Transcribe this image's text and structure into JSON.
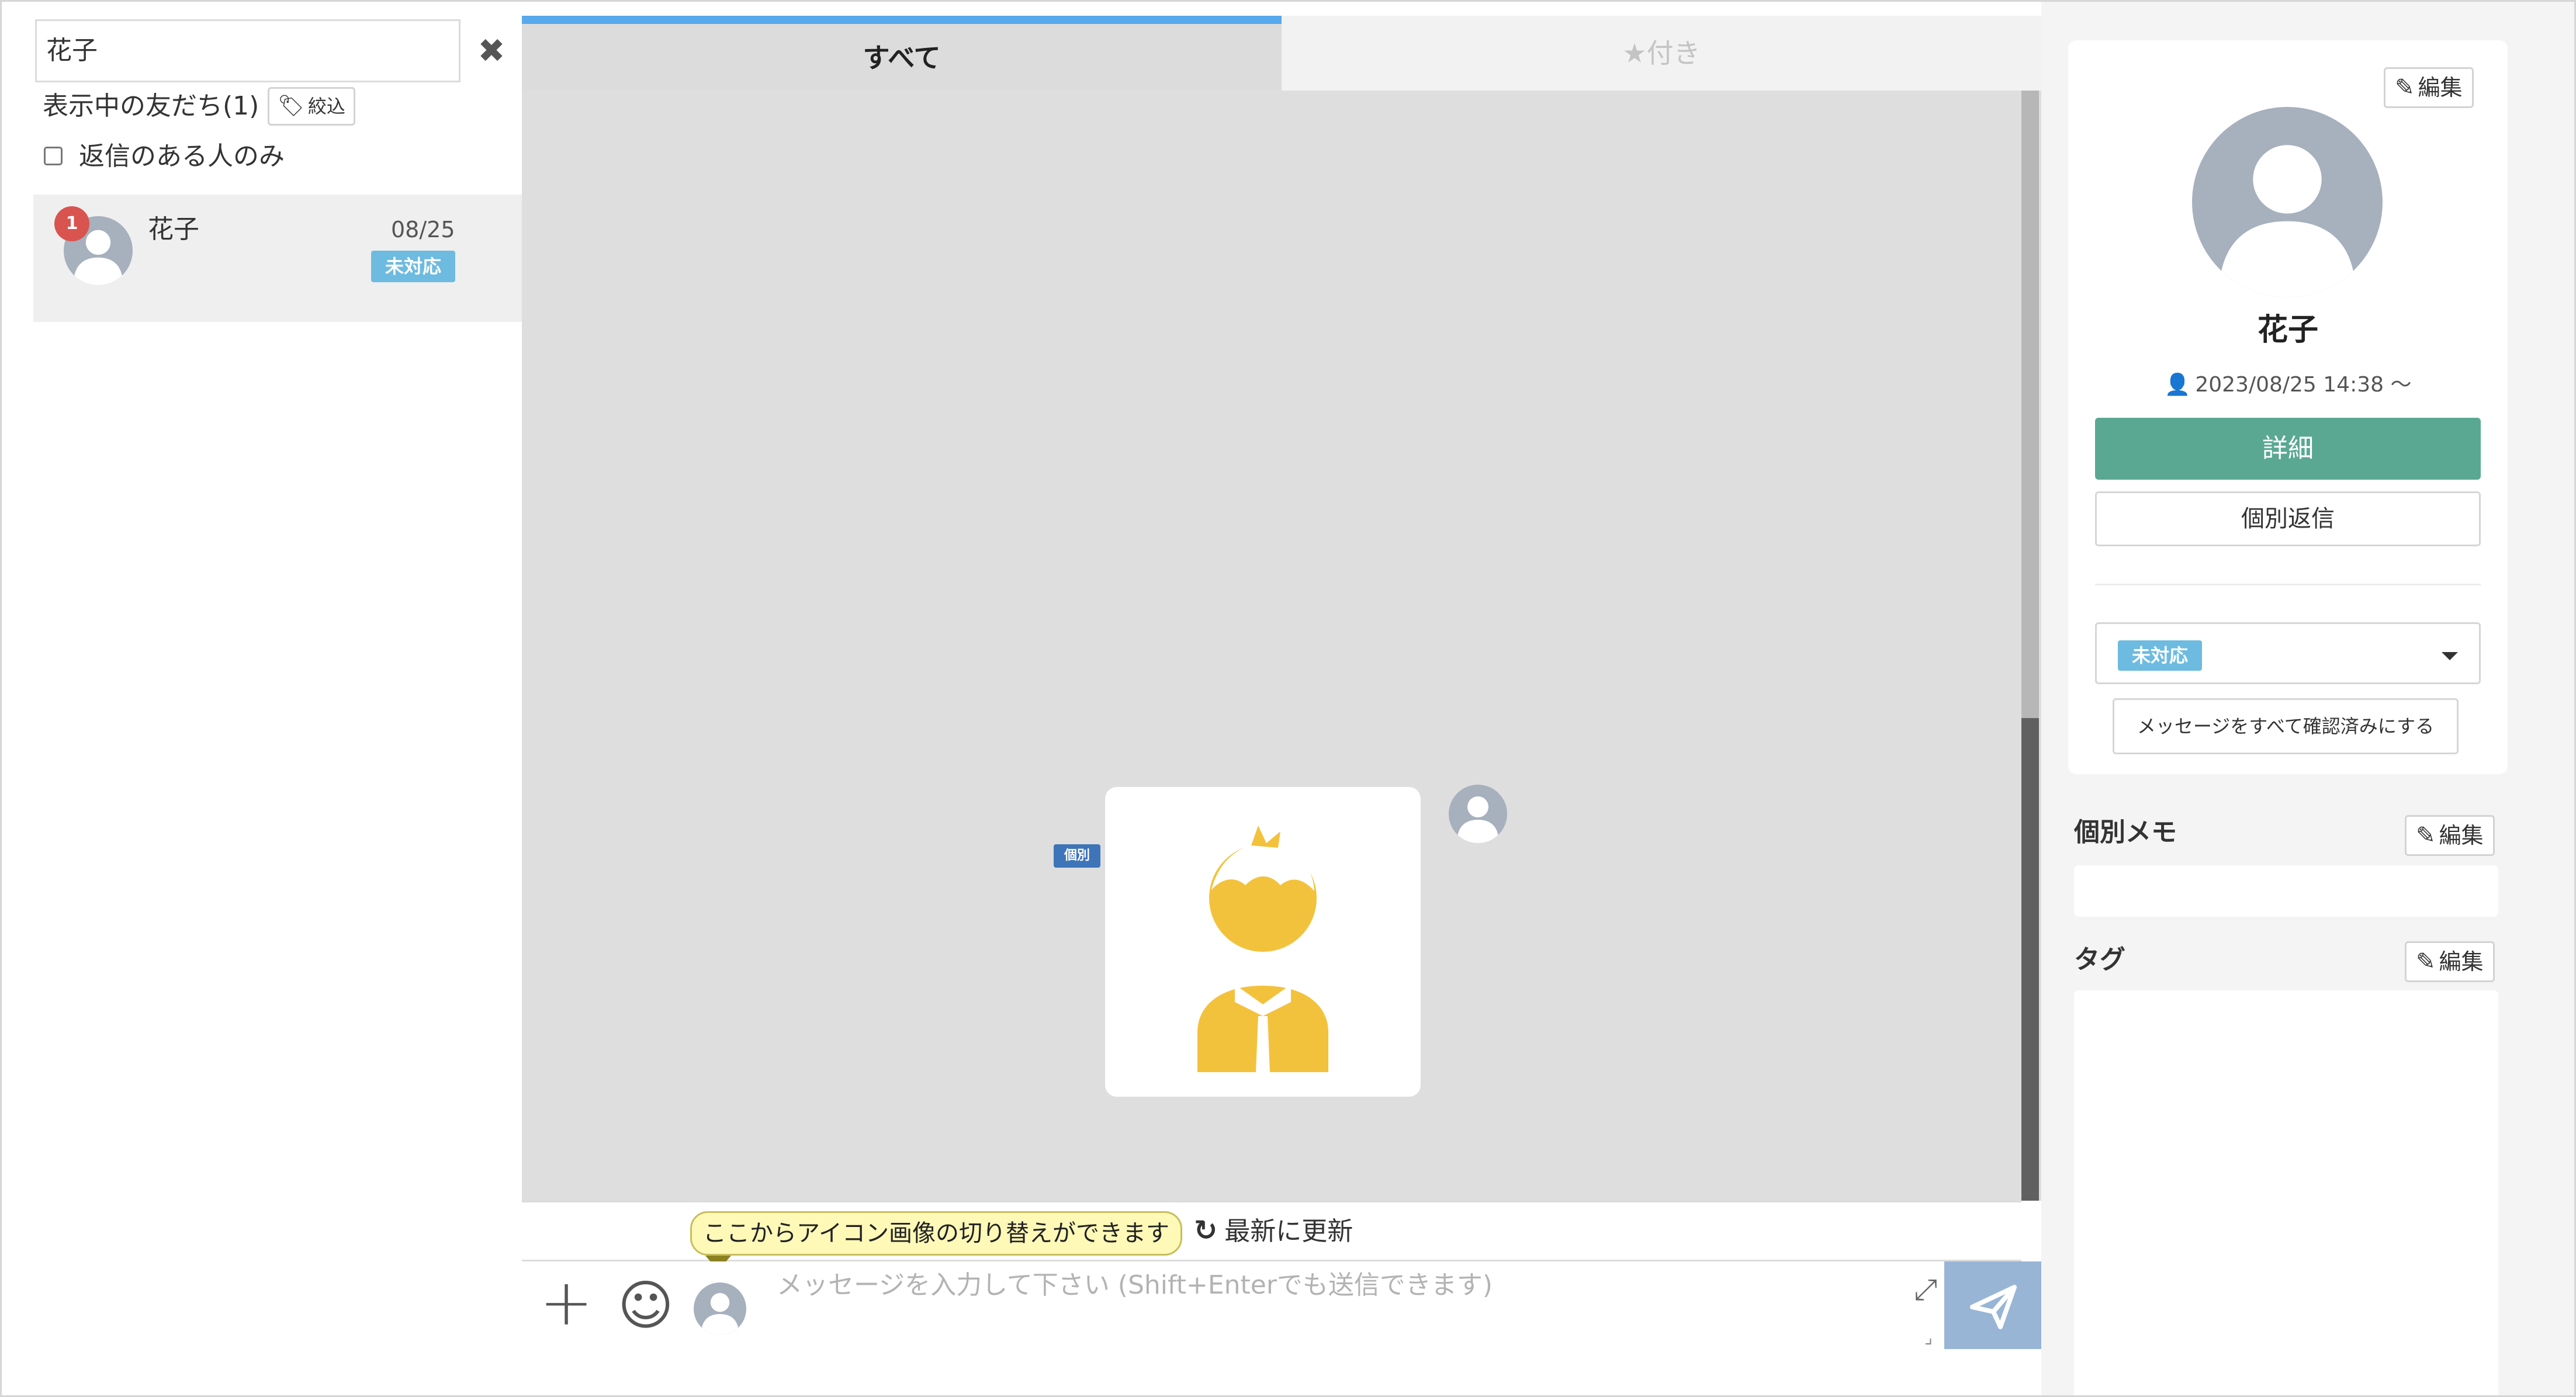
{
  "sidebar": {
    "search": {
      "value": "花子",
      "clear_icon": "✖"
    },
    "friends_count_label": "表示中の友だち(1)",
    "filter_label": "絞込",
    "reply_only_label": "返信のある人のみ",
    "friends": [
      {
        "name": "花子",
        "date": "08/25",
        "status": "未対応",
        "unread": "1"
      }
    ]
  },
  "tabs": {
    "all": "すべて",
    "starred": "★付き"
  },
  "chat": {
    "message_tag": "個別",
    "sticker": "boy-character-image"
  },
  "toolbar": {
    "tooltip": "ここからアイコン画像の切り替えができます",
    "refresh_label": "最新に更新"
  },
  "composer": {
    "placeholder": "メッセージを入力して下さい (Shift+Enterでも送信できます)"
  },
  "profile": {
    "edit_label": "編集",
    "name": "花子",
    "since": "2023/08/25 14:38 〜",
    "detail_label": "詳細",
    "reply_label": "個別返信",
    "status": "未対応",
    "mark_read_label": "メッセージをすべて確認済みにする"
  },
  "memo": {
    "title": "個別メモ",
    "edit_label": "編集"
  },
  "tag_section": {
    "title": "タグ",
    "edit_label": "編集"
  },
  "colors": {
    "accent_tab": "#58a8ec",
    "detail_button": "#5aa891",
    "status_badge": "#6dbbe0",
    "unread_badge": "#d9534f",
    "send_button": "#98b5d6",
    "sticker_yellow": "#f3c23c"
  }
}
